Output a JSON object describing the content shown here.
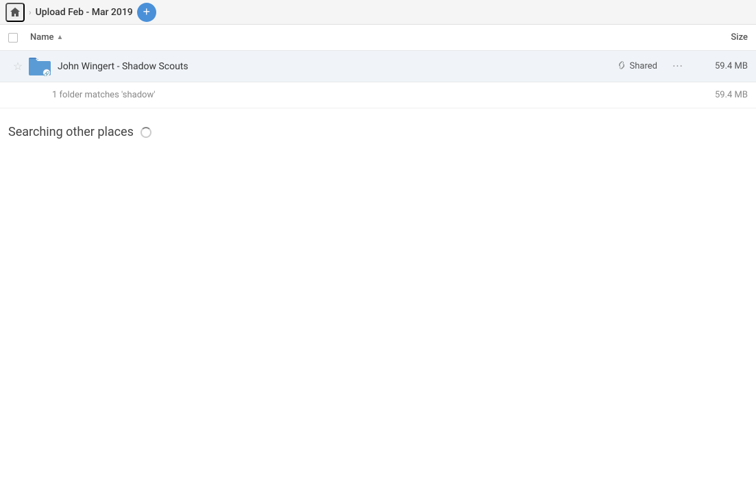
{
  "topbar": {
    "title": "Upload Feb - Mar 2019",
    "home_label": "Home",
    "add_label": "+"
  },
  "columns": {
    "name_label": "Name",
    "size_label": "Size"
  },
  "file_row": {
    "name": "John Wingert - Shadow Scouts",
    "shared_label": "Shared",
    "size": "59.4 MB",
    "more_label": "..."
  },
  "match_row": {
    "text": "1 folder matches 'shadow'",
    "size": "59.4 MB"
  },
  "searching_section": {
    "text": "Searching other places"
  },
  "icons": {
    "home": "🏠",
    "star_empty": "☆",
    "link": "🔗",
    "more": "•••"
  }
}
